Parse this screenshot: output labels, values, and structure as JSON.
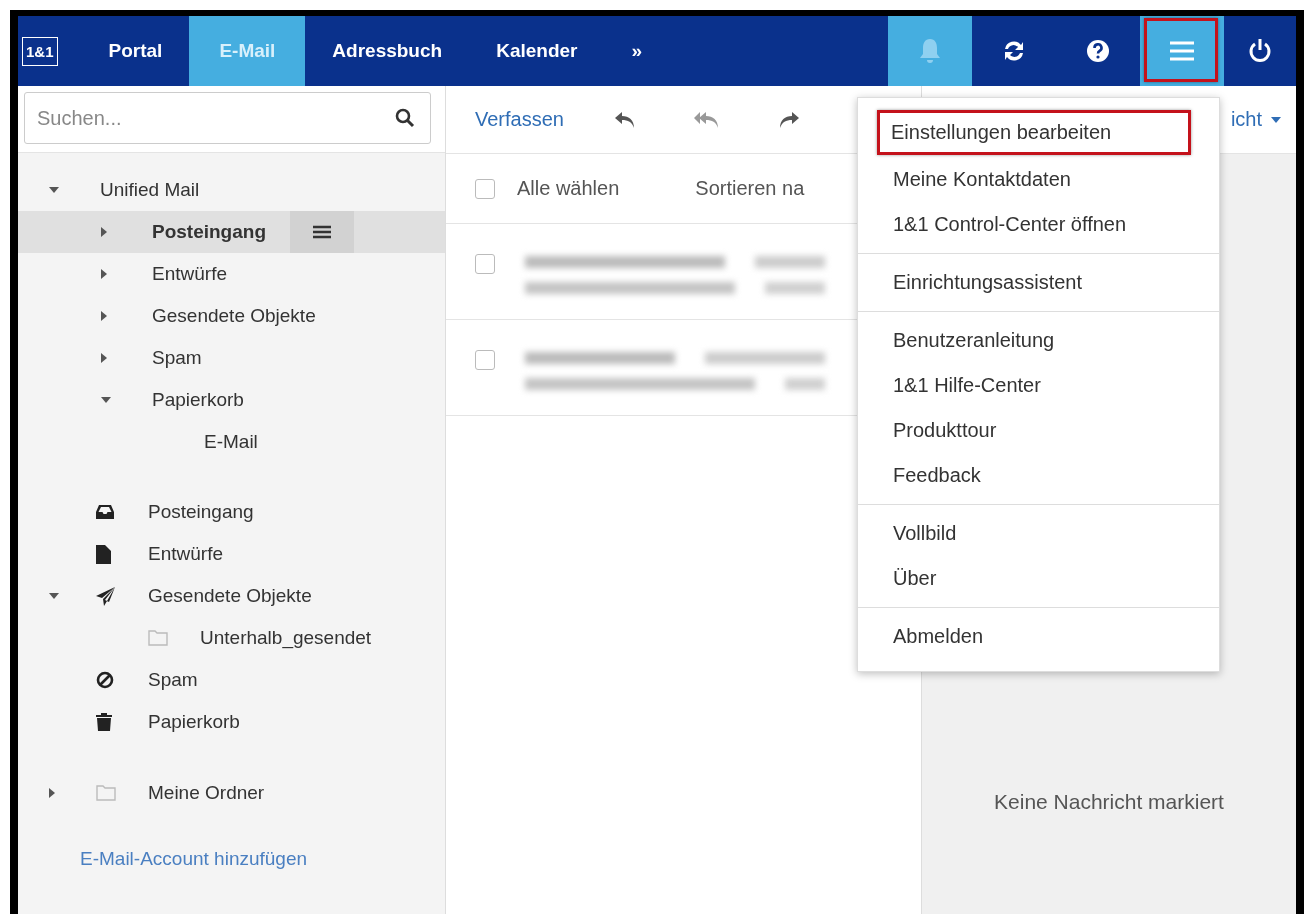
{
  "nav": {
    "logo": "1&1",
    "tabs": [
      {
        "label": "Portal",
        "selected": false
      },
      {
        "label": "E-Mail",
        "selected": true
      },
      {
        "label": "Adressbuch",
        "selected": false
      },
      {
        "label": "Kalender",
        "selected": false
      },
      {
        "label": "»",
        "selected": false
      }
    ],
    "actions": [
      {
        "kind": "bell",
        "selected": true
      },
      {
        "kind": "refresh",
        "selected": false
      },
      {
        "kind": "help",
        "selected": false
      },
      {
        "kind": "menu",
        "selected": true,
        "annotated": true
      },
      {
        "kind": "power",
        "selected": false
      }
    ]
  },
  "search": {
    "placeholder": "Suchen..."
  },
  "unified_tree": [
    {
      "label": "Unified Mail",
      "expanded": true,
      "selected": false,
      "children": [
        {
          "label": "Posteingang",
          "expanded": false,
          "selected": true
        },
        {
          "label": "Entwürfe",
          "expanded": false,
          "selected": false
        },
        {
          "label": "Gesendete Objekte",
          "expanded": false,
          "selected": false
        },
        {
          "label": "Spam",
          "expanded": false,
          "selected": false
        },
        {
          "label": "Papierkorb",
          "expanded": true,
          "selected": false,
          "children": [
            {
              "label": "E-Mail",
              "selected": false
            }
          ]
        }
      ]
    }
  ],
  "folders": [
    {
      "kind": "inbox",
      "label": "Posteingang"
    },
    {
      "kind": "drafts",
      "label": "Entwürfe"
    },
    {
      "kind": "sent",
      "label": "Gesendete Objekte",
      "expanded": true,
      "children": [
        {
          "kind": "folder",
          "label": "Unterhalb_gesendet"
        }
      ]
    },
    {
      "kind": "spam",
      "label": "Spam"
    },
    {
      "kind": "trash",
      "label": "Papierkorb"
    },
    {
      "kind": "folder",
      "label": "Meine Ordner",
      "expanded": false
    }
  ],
  "add_account_link": "E-Mail-Account hinzufügen",
  "toolbar": {
    "compose": "Verfassen",
    "view": "icht"
  },
  "list": {
    "select_all": {
      "label": "Alle wählen",
      "checked": false
    },
    "sort": "Sortieren na",
    "rows": [
      {
        "checked": false
      },
      {
        "checked": false
      }
    ]
  },
  "reading_pane": {
    "empty": "Keine Nachricht markiert"
  },
  "menu": {
    "groups": [
      [
        {
          "label": "Einstellungen bearbeiten",
          "annotated": true
        },
        {
          "label": "Meine Kontaktdaten",
          "annotated": false
        },
        {
          "label": "1&1 Control-Center öffnen",
          "annotated": false
        }
      ],
      [
        {
          "label": "Einrichtungsassistent",
          "annotated": false
        }
      ],
      [
        {
          "label": "Benutzeranleitung",
          "annotated": false
        },
        {
          "label": "1&1 Hilfe-Center",
          "annotated": false
        },
        {
          "label": "Produkttour",
          "annotated": false
        },
        {
          "label": "Feedback",
          "annotated": false
        }
      ],
      [
        {
          "label": "Vollbild",
          "annotated": false
        },
        {
          "label": "Über",
          "annotated": false
        }
      ],
      [
        {
          "label": "Abmelden",
          "annotated": false
        }
      ]
    ]
  }
}
